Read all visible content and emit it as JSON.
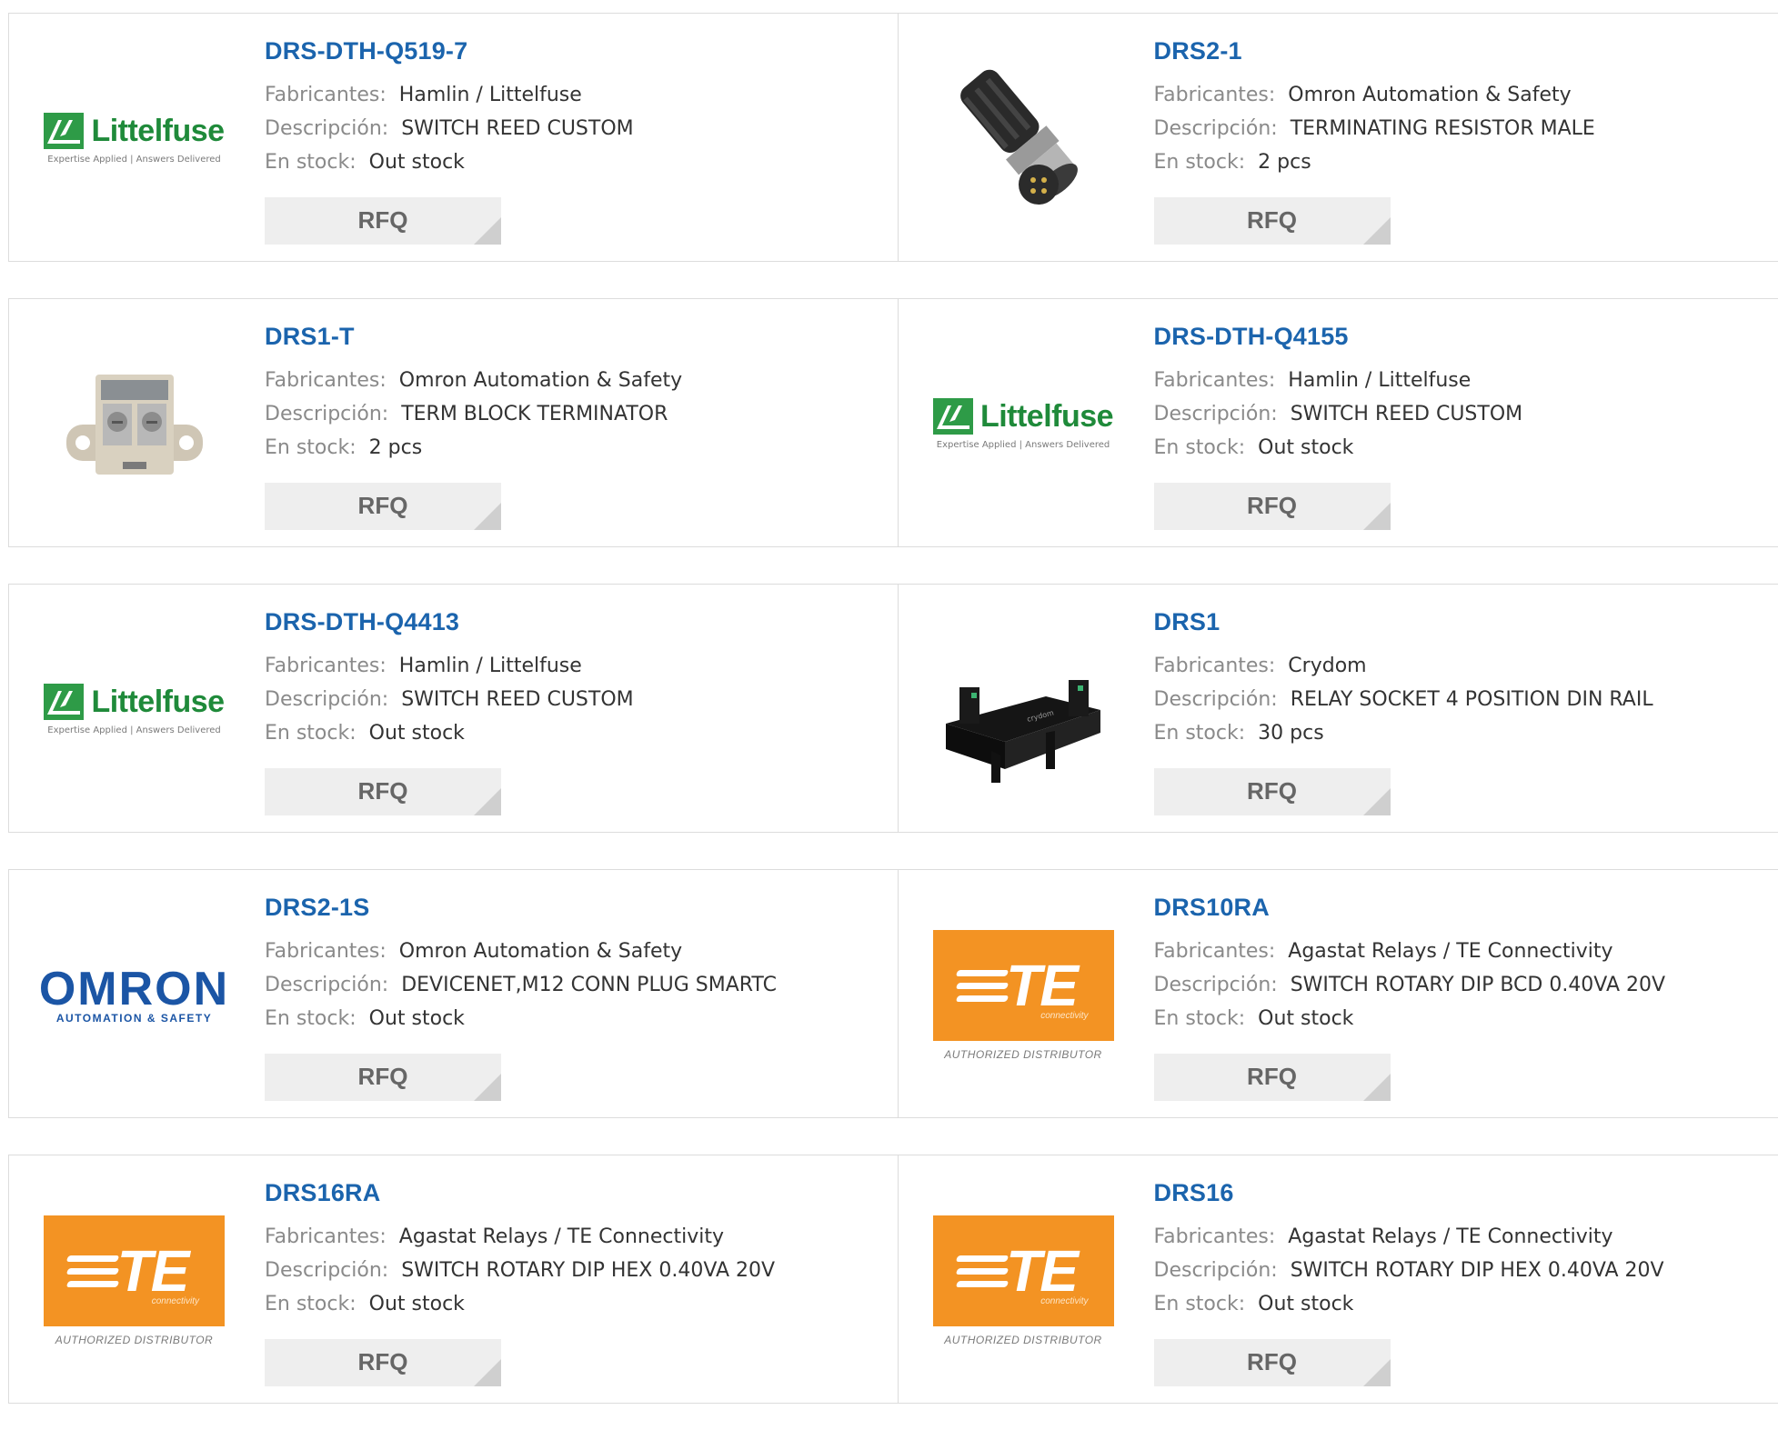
{
  "labels": {
    "manufacturer": "Fabricantes:",
    "description": "Descripción:",
    "stock": "En stock:",
    "rfq": "RFQ"
  },
  "logos": {
    "littelfuse": {
      "name": "Littelfuse",
      "tagline": "Expertise Applied | Answers Delivered"
    },
    "omron": {
      "name": "OMRON",
      "tagline": "AUTOMATION & SAFETY"
    },
    "te": {
      "name": "TE",
      "sub": "connectivity",
      "authorized": "AUTHORIZED DISTRIBUTOR"
    }
  },
  "colors": {
    "link": "#1b64ad",
    "littelfuse_green": "#1f8a3a",
    "te_orange": "#f39323",
    "omron_blue": "#1b55a5"
  },
  "products": [
    {
      "part": "DRS-DTH-Q519-7",
      "manufacturer": "Hamlin / Littelfuse",
      "description": "SWITCH REED CUSTOM",
      "stock": "Out stock",
      "image": "littelfuse-logo"
    },
    {
      "part": "DRS2-1",
      "manufacturer": "Omron Automation & Safety",
      "description": "TERMINATING RESISTOR MALE",
      "stock": "2 pcs",
      "image": "m12-connector-photo"
    },
    {
      "part": "DRS1-T",
      "manufacturer": "Omron Automation & Safety",
      "description": "TERM BLOCK TERMINATOR",
      "stock": "2 pcs",
      "image": "terminal-block-photo"
    },
    {
      "part": "DRS-DTH-Q4155",
      "manufacturer": "Hamlin / Littelfuse",
      "description": "SWITCH REED CUSTOM",
      "stock": "Out stock",
      "image": "littelfuse-logo"
    },
    {
      "part": "DRS-DTH-Q4413",
      "manufacturer": "Hamlin / Littelfuse",
      "description": "SWITCH REED CUSTOM",
      "stock": "Out stock",
      "image": "littelfuse-logo"
    },
    {
      "part": "DRS1",
      "manufacturer": "Crydom",
      "description": "RELAY SOCKET 4 POSITION DIN RAIL",
      "stock": "30 pcs",
      "image": "din-rail-socket-photo"
    },
    {
      "part": "DRS2-1S",
      "manufacturer": "Omron Automation & Safety",
      "description": "DEVICENET,M12 CONN PLUG SMARTC",
      "stock": "Out stock",
      "image": "omron-logo"
    },
    {
      "part": "DRS10RA",
      "manufacturer": "Agastat Relays / TE Connectivity",
      "description": "SWITCH ROTARY DIP BCD 0.40VA 20V",
      "stock": "Out stock",
      "image": "te-logo"
    },
    {
      "part": "DRS16RA",
      "manufacturer": "Agastat Relays / TE Connectivity",
      "description": "SWITCH ROTARY DIP HEX 0.40VA 20V",
      "stock": "Out stock",
      "image": "te-logo"
    },
    {
      "part": "DRS16",
      "manufacturer": "Agastat Relays / TE Connectivity",
      "description": "SWITCH ROTARY DIP HEX 0.40VA 20V",
      "stock": "Out stock",
      "image": "te-logo"
    }
  ]
}
